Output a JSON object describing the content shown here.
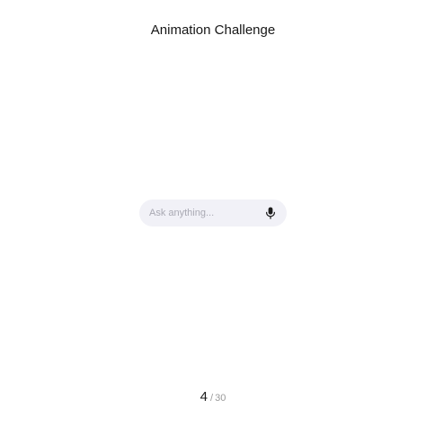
{
  "header": {
    "title": "Animation Challenge"
  },
  "search": {
    "placeholder": "Ask anything...",
    "value": ""
  },
  "icons": {
    "mic": "microphone-icon"
  },
  "pagination": {
    "current": "4",
    "separator": "/",
    "total": "30"
  },
  "colors": {
    "background": "#ffffff",
    "input_background": "#f1f1f7",
    "placeholder": "#a9a9b3",
    "title_text": "#161616"
  }
}
